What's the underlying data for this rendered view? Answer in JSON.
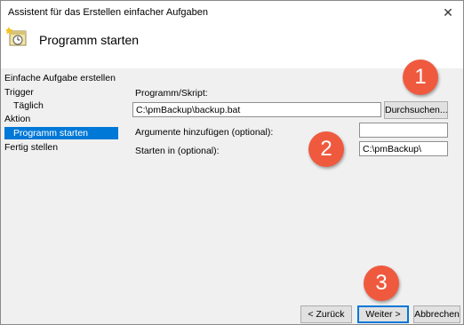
{
  "window": {
    "title": "Assistent für das Erstellen einfacher Aufgaben",
    "close_glyph": "✕"
  },
  "header": {
    "heading": "Programm starten",
    "icon": "task-wizard-clock-icon"
  },
  "sidebar": {
    "items": [
      {
        "label": "Einfache Aufgabe erstellen"
      },
      {
        "label": "Trigger"
      },
      {
        "label": "Täglich"
      },
      {
        "label": "Aktion"
      },
      {
        "label": "Programm starten",
        "selected": true
      },
      {
        "label": "Fertig stellen"
      }
    ]
  },
  "form": {
    "program_label": "Programm/Skript:",
    "program_value": "C:\\pmBackup\\backup.bat",
    "browse_label": "Durchsuchen...",
    "args_label": "Argumente hinzufügen (optional):",
    "args_value": "",
    "startin_label": "Starten in (optional):",
    "startin_value": "C:\\pmBackup\\"
  },
  "footer": {
    "back_label": "< Zurück",
    "next_label": "Weiter >",
    "cancel_label": "Abbrechen"
  },
  "annotations": {
    "badge1": "1",
    "badge2": "2",
    "badge3": "3",
    "color": "#ef5a3f"
  }
}
